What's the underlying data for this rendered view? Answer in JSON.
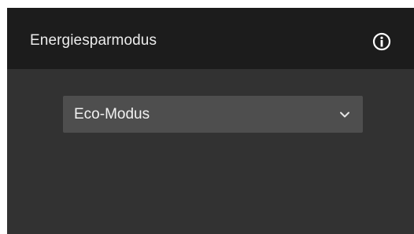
{
  "panel": {
    "title": "Energiesparmodus",
    "info_icon": "info-circle-icon"
  },
  "mode_select": {
    "selected_value": "Eco-Modus",
    "dropdown_icon": "chevron-down-icon"
  },
  "colors": {
    "panel_background": "#323232",
    "header_background": "#1c1c1c",
    "select_background": "#4e4e4e",
    "text": "#ececec"
  }
}
